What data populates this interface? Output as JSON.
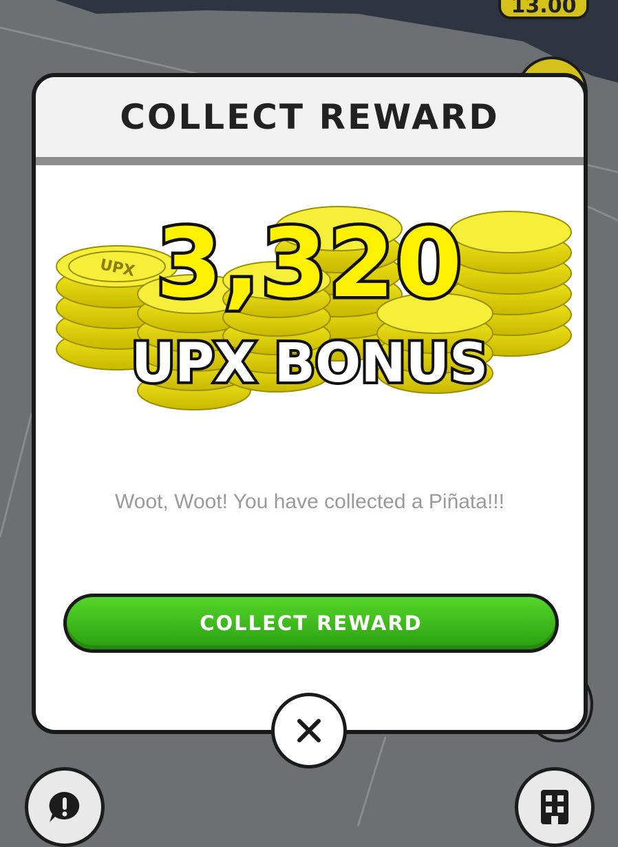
{
  "background": {
    "balance_text": "13.00",
    "colors": {
      "map": "#6e6f72",
      "road": "#2f3540",
      "accent_yellow": "#d4c21a"
    }
  },
  "modal": {
    "title": "COLLECT REWARD",
    "reward_amount": "3,320",
    "reward_label": "UPX BONUS",
    "coin_text": "UPX",
    "message": "Woot, Woot! You have collected a Piñata!!!",
    "collect_button_label": "COLLECT REWARD",
    "close_icon": "close-icon",
    "colors": {
      "button_green": "#3cb81a",
      "reward_yellow": "#fff200",
      "coin_yellow": "#f4ec1e"
    }
  },
  "corner_buttons": {
    "left_icon": "alert-chat-icon",
    "right_icon": "building-icon"
  }
}
